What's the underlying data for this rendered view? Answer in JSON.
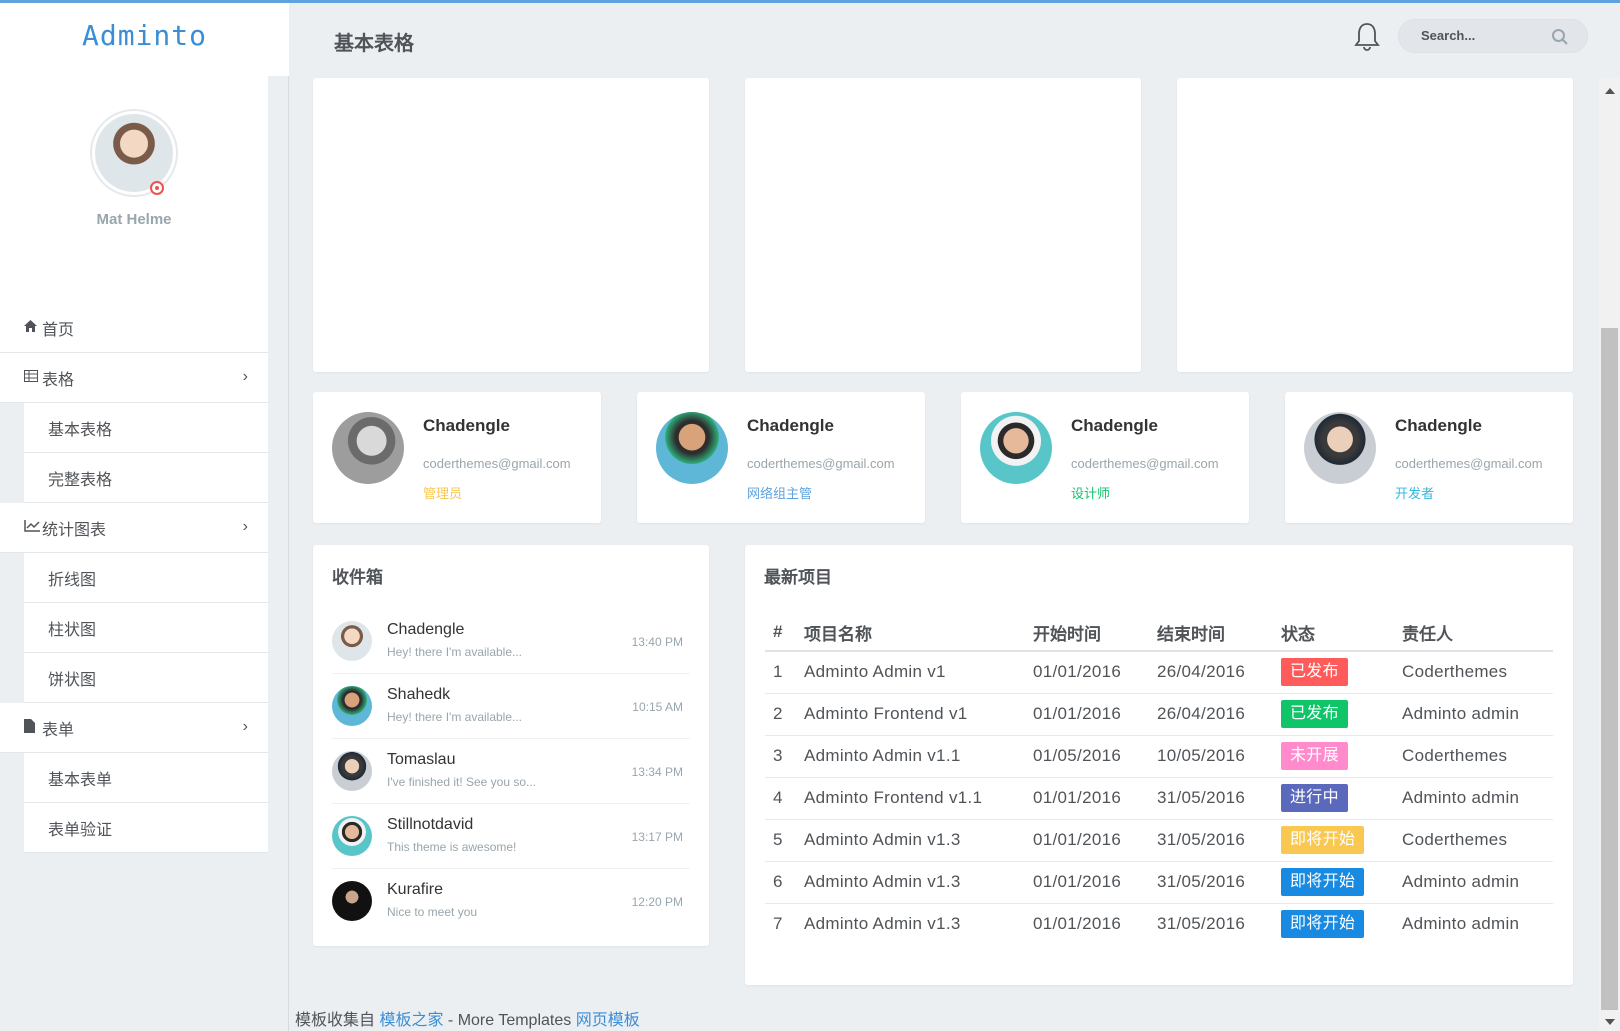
{
  "brand": "Adminto",
  "user": {
    "name": "Mat Helme"
  },
  "menu": {
    "home": "首页",
    "tables": "表格",
    "tables_basic": "基本表格",
    "tables_full": "完整表格",
    "charts": "统计图表",
    "charts_line": "折线图",
    "charts_bar": "柱状图",
    "charts_pie": "饼状图",
    "forms": "表单",
    "forms_basic": "基本表单",
    "forms_validate": "表单验证"
  },
  "header": {
    "title": "基本表格",
    "search_placeholder": "Search..."
  },
  "contacts": [
    {
      "name": "Chadengle",
      "email": "coderthemes@gmail.com",
      "role": "管理员",
      "role_color": "#f9c851"
    },
    {
      "name": "Chadengle",
      "email": "coderthemes@gmail.com",
      "role": "网络组主管",
      "role_color": "#5fa2dd"
    },
    {
      "name": "Chadengle",
      "email": "coderthemes@gmail.com",
      "role": "设计师",
      "role_color": "#10c469"
    },
    {
      "name": "Chadengle",
      "email": "coderthemes@gmail.com",
      "role": "开发者",
      "role_color": "#35b8e0"
    }
  ],
  "inbox": {
    "title": "收件箱",
    "items": [
      {
        "name": "Chadengle",
        "message": "Hey! there I'm available...",
        "time": "13:40 PM"
      },
      {
        "name": "Shahedk",
        "message": "Hey! there I'm available...",
        "time": "10:15 AM"
      },
      {
        "name": "Tomaslau",
        "message": "I've finished it! See you so...",
        "time": "13:34 PM"
      },
      {
        "name": "Stillnotdavid",
        "message": "This theme is awesome!",
        "time": "13:17 PM"
      },
      {
        "name": "Kurafire",
        "message": "Nice to meet you",
        "time": "12:20 PM"
      }
    ]
  },
  "projects": {
    "title": "最新项目",
    "headers": [
      "#",
      "项目名称",
      "开始时间",
      "结束时间",
      "状态",
      "责任人"
    ],
    "rows": [
      {
        "id": "1",
        "name": "Adminto Admin v1",
        "start": "01/01/2016",
        "end": "26/04/2016",
        "status": "已发布",
        "status_color": "#ff5b5b",
        "owner": "Coderthemes"
      },
      {
        "id": "2",
        "name": "Adminto Frontend v1",
        "start": "01/01/2016",
        "end": "26/04/2016",
        "status": "已发布",
        "status_color": "#10c469",
        "owner": "Adminto admin"
      },
      {
        "id": "3",
        "name": "Adminto Admin v1.1",
        "start": "01/05/2016",
        "end": "10/05/2016",
        "status": "未开展",
        "status_color": "#ff8acc",
        "owner": "Coderthemes"
      },
      {
        "id": "4",
        "name": "Adminto Frontend v1.1",
        "start": "01/01/2016",
        "end": "31/05/2016",
        "status": "进行中",
        "status_color": "#5b69bc",
        "owner": "Adminto admin"
      },
      {
        "id": "5",
        "name": "Adminto Admin v1.3",
        "start": "01/01/2016",
        "end": "31/05/2016",
        "status": "即将开始",
        "status_color": "#f9c851",
        "owner": "Coderthemes"
      },
      {
        "id": "6",
        "name": "Adminto Admin v1.3",
        "start": "01/01/2016",
        "end": "31/05/2016",
        "status": "即将开始",
        "status_color": "#188ae2",
        "owner": "Adminto admin"
      },
      {
        "id": "7",
        "name": "Adminto Admin v1.3",
        "start": "01/01/2016",
        "end": "31/05/2016",
        "status": "即将开始",
        "status_color": "#188ae2",
        "owner": "Adminto admin"
      }
    ]
  },
  "footer": {
    "prefix": "模板收集自",
    "link1": "模板之家",
    "middle": " - More Templates ",
    "link2": "网页模板"
  }
}
